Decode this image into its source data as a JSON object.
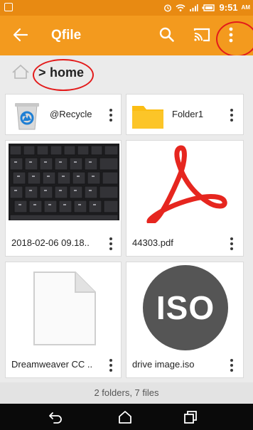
{
  "status_bar": {
    "time": "9:51",
    "ampm": "AM"
  },
  "app_bar": {
    "title": "Qfile",
    "back_icon": "arrow-left-icon",
    "search_icon": "search-icon",
    "cast_icon": "cast-icon",
    "more_icon": "more-vert-icon"
  },
  "breadcrumb": {
    "home_icon": "house-icon",
    "current": "home"
  },
  "files": [
    {
      "name": "@Recycle",
      "kind": "recycle-folder"
    },
    {
      "name": "Folder1",
      "kind": "folder"
    },
    {
      "name": "2018-02-06 09.18..",
      "kind": "image"
    },
    {
      "name": "44303.pdf",
      "kind": "pdf"
    },
    {
      "name": "Dreamweaver CC ..",
      "kind": "document"
    },
    {
      "name": "drive image.iso",
      "kind": "iso"
    }
  ],
  "iso_label": "ISO",
  "footer": {
    "summary": "2 folders, 7 files"
  },
  "colors": {
    "accent": "#f39a1e",
    "status_bar": "#e88a12",
    "folder": "#fbbd14",
    "pdf_red": "#e6261f",
    "annotation_red": "#e31b1b"
  }
}
